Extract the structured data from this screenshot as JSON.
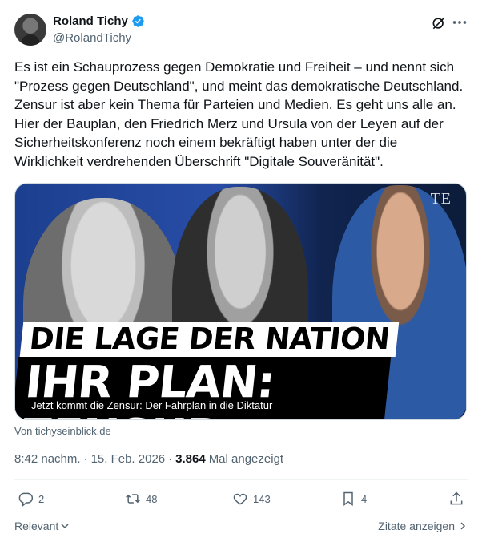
{
  "author": {
    "display_name": "Roland Tichy",
    "handle": "@RolandTichy",
    "verified_color": "#1d9bf0"
  },
  "post": {
    "text": "Es ist ein Schauprozess gegen Demokratie und Freiheit – und nennt sich \"Prozess gegen Deutschland\", und meint das demokratische Deutschland. Zensur ist aber kein Thema für Parteien und Medien. Es geht uns alle an. Hier der Bauplan, den Friedrich Merz und Ursula von der Leyen auf der Sicherheitskonferenz noch einem bekräftigt haben unter der die Wirklichkeit verdrehenden Überschrift \"Digitale Souveränität\".",
    "time": "8:42 nachm.",
    "separator": "·",
    "date": "15. Feb. 2026",
    "views": "3.864",
    "views_label": "Mal angezeigt"
  },
  "media": {
    "headline_top": "DIE LAGE DER NATION",
    "headline_bottom": "IHR PLAN: ZENSUR",
    "brand": "TE",
    "caption": "Jetzt kommt die Zensur: Der Fahrplan in die Diktatur",
    "source": "Von tichyseinblick.de"
  },
  "actions": {
    "replies": "2",
    "retweets": "48",
    "likes": "143",
    "bookmarks": "4"
  },
  "footer": {
    "sort_label": "Relevant",
    "quotes_label": "Zitate anzeigen"
  },
  "icons": {
    "verified": "verified-badge-icon",
    "grok": "grok-icon",
    "more": "more-icon",
    "reply": "reply-icon",
    "retweet": "retweet-icon",
    "like": "heart-icon",
    "bookmark": "bookmark-icon",
    "share": "share-icon"
  }
}
